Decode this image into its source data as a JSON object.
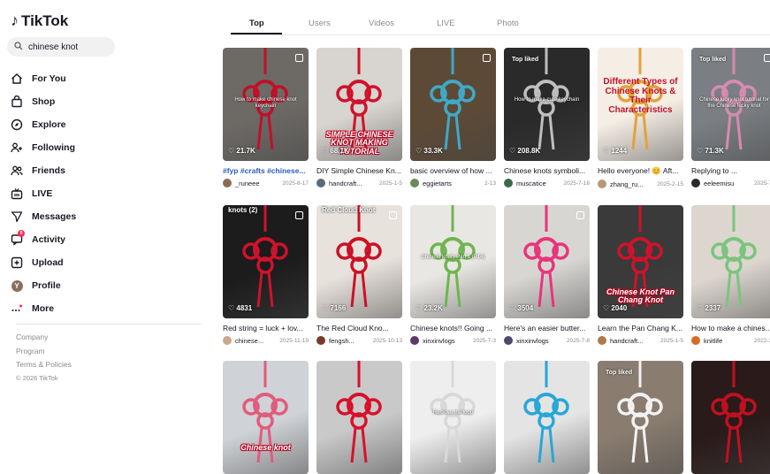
{
  "app": {
    "logo_text": "TikTok",
    "logo_icon": "tiktok-note-icon"
  },
  "search": {
    "value": "chinese knot",
    "icon": "search-icon"
  },
  "nav": [
    {
      "label": "For You",
      "icon": "home-icon"
    },
    {
      "label": "Shop",
      "icon": "shopping-bag-icon"
    },
    {
      "label": "Explore",
      "icon": "compass-icon"
    },
    {
      "label": "Following",
      "icon": "person-plus-icon"
    },
    {
      "label": "Friends",
      "icon": "people-icon"
    },
    {
      "label": "LIVE",
      "icon": "live-tv-icon"
    },
    {
      "label": "Messages",
      "icon": "paper-plane-icon"
    },
    {
      "label": "Activity",
      "icon": "message-icon",
      "badge": "9"
    },
    {
      "label": "Upload",
      "icon": "plus-square-icon"
    },
    {
      "label": "Profile",
      "icon": "avatar",
      "avatar_letter": "Y"
    },
    {
      "label": "More",
      "icon": "more-dots-icon"
    }
  ],
  "footer": {
    "links": [
      "Company",
      "Program",
      "Terms & Policies"
    ],
    "copyright": "© 2026 TikTok"
  },
  "tabs": [
    "Top",
    "Users",
    "Videos",
    "LIVE",
    "Photo"
  ],
  "active_tab": "Top",
  "videos": [
    {
      "likes": "21.7K",
      "desc": "#fyp #crafts #chinese...",
      "user": "_runeee",
      "date": "2025-8-17",
      "overlay_small": "How to make chinese knot keychain",
      "bg": "#6d6a66",
      "accent": "#c0102a",
      "multi": true
    },
    {
      "likes": "68.1K",
      "desc": "DIY Simple Chinese Kn...",
      "user": "handcraft...",
      "date": "2025-1-5",
      "overlay": "SIMPLE CHINESE KNOT MAKING TUTORIAL",
      "bg": "#d8d4cf",
      "accent": "#d0122c"
    },
    {
      "likes": "33.3K",
      "desc": "basic overview of how ...",
      "user": "eggietarts",
      "date": "2-13",
      "bg": "#5d4a36",
      "accent": "#3fa9c9",
      "multi": true
    },
    {
      "likes": "208.8K",
      "desc": "Chinese knots symboli...",
      "user": "muscatice",
      "date": "2025-7-18",
      "badge": "Top liked",
      "overlay_small": "How to make cute keychain",
      "bg": "#2a2a2a",
      "accent": "#bfbfbf"
    },
    {
      "likes": "1244",
      "desc": "Hello everyone! 😊 Aft...",
      "user": "zhang_ru...",
      "date": "2025-2-15",
      "overlay_title": "Different Types of Chinese Knots & Their Characteristics",
      "bg": "#f4eee4",
      "accent": "#e2a23b"
    },
    {
      "likes": "71.3K",
      "desc": "Replying to ...",
      "user": "eeleemisu",
      "date": "2025-7-3",
      "badge": "Top liked",
      "overlay_small": "Chinese lucky knot tutorial for the Chinese lucky knot",
      "bg": "#7b7f83",
      "accent": "#d68bb0",
      "multi": true
    },
    {
      "likes": "4831",
      "desc": "Red string = luck + lov...",
      "user": "chinese...",
      "date": "2025-11-19",
      "overlay_top": "knots (2)",
      "bg": "#1c1c1c",
      "accent": "#d0122c",
      "multi": true
    },
    {
      "likes": "7166",
      "desc": "The Red Cloud Kno...",
      "user": "fengsh...",
      "date": "2025-10-13",
      "overlay_top": "Red Cloud Knot",
      "bg": "#e8e2dc",
      "accent": "#cc1026",
      "multi": true
    },
    {
      "likes": "23.2K",
      "desc": "Chinese knots!! Going ...",
      "user": "xinxinvlogs",
      "date": "2025-7-3",
      "overlay_small": "Chinese knots Part 1 (P14)",
      "bg": "#e9e7e3",
      "accent": "#6fb54e"
    },
    {
      "likes": "3504",
      "desc": "Here's an easier butter...",
      "user": "xinxinvlogs",
      "date": "2025-7-8",
      "bg": "#d8d6d3",
      "accent": "#e8347a",
      "multi": true
    },
    {
      "likes": "2040",
      "desc": "Learn the Pan Chang K...",
      "user": "handcraft...",
      "date": "2025-1-5",
      "overlay": "Chinese Knot Pan Chang Knot",
      "bg": "#3a3a3a",
      "accent": "#d0122c"
    },
    {
      "likes": "2337",
      "desc": "How to make a chines...",
      "user": "knitlife",
      "date": "2022-3-2",
      "bg": "#dcd6cf",
      "accent": "#7bc47f"
    },
    {
      "likes": "",
      "desc": "",
      "user": "",
      "date": "",
      "overlay": "Chinese knot",
      "bg": "#cfd2d6",
      "accent": "#e25b7a"
    },
    {
      "likes": "",
      "desc": "",
      "user": "",
      "date": "",
      "bg": "#c9c9c9",
      "accent": "#d8102a"
    },
    {
      "likes": "",
      "desc": "",
      "user": "",
      "date": "",
      "overlay_small": "Remove the loop",
      "bg": "#eeeeee",
      "accent": "#d8d8d8"
    },
    {
      "likes": "",
      "desc": "",
      "user": "",
      "date": "",
      "bg": "#e4e4e4",
      "accent": "#27a7d8"
    },
    {
      "likes": "",
      "desc": "",
      "user": "",
      "date": "",
      "badge": "Top liked",
      "bg": "#8a7d70",
      "accent": "#f2f2f2"
    },
    {
      "likes": "",
      "desc": "",
      "user": "",
      "date": "",
      "bg": "#2a1a1a",
      "accent": "#c01020"
    }
  ]
}
